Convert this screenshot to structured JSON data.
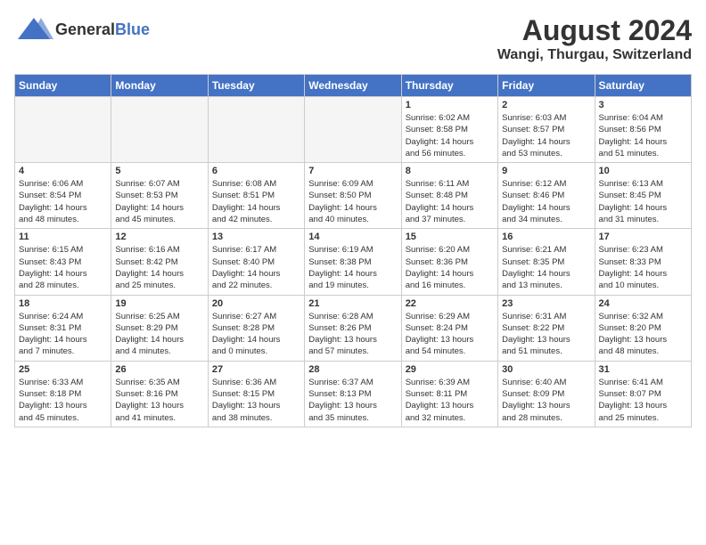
{
  "header": {
    "logo_general": "General",
    "logo_blue": "Blue",
    "month_year": "August 2024",
    "location": "Wangi, Thurgau, Switzerland"
  },
  "days_of_week": [
    "Sunday",
    "Monday",
    "Tuesday",
    "Wednesday",
    "Thursday",
    "Friday",
    "Saturday"
  ],
  "weeks": [
    [
      {
        "day": "",
        "info": ""
      },
      {
        "day": "",
        "info": ""
      },
      {
        "day": "",
        "info": ""
      },
      {
        "day": "",
        "info": ""
      },
      {
        "day": "1",
        "info": "Sunrise: 6:02 AM\nSunset: 8:58 PM\nDaylight: 14 hours\nand 56 minutes."
      },
      {
        "day": "2",
        "info": "Sunrise: 6:03 AM\nSunset: 8:57 PM\nDaylight: 14 hours\nand 53 minutes."
      },
      {
        "day": "3",
        "info": "Sunrise: 6:04 AM\nSunset: 8:56 PM\nDaylight: 14 hours\nand 51 minutes."
      }
    ],
    [
      {
        "day": "4",
        "info": "Sunrise: 6:06 AM\nSunset: 8:54 PM\nDaylight: 14 hours\nand 48 minutes."
      },
      {
        "day": "5",
        "info": "Sunrise: 6:07 AM\nSunset: 8:53 PM\nDaylight: 14 hours\nand 45 minutes."
      },
      {
        "day": "6",
        "info": "Sunrise: 6:08 AM\nSunset: 8:51 PM\nDaylight: 14 hours\nand 42 minutes."
      },
      {
        "day": "7",
        "info": "Sunrise: 6:09 AM\nSunset: 8:50 PM\nDaylight: 14 hours\nand 40 minutes."
      },
      {
        "day": "8",
        "info": "Sunrise: 6:11 AM\nSunset: 8:48 PM\nDaylight: 14 hours\nand 37 minutes."
      },
      {
        "day": "9",
        "info": "Sunrise: 6:12 AM\nSunset: 8:46 PM\nDaylight: 14 hours\nand 34 minutes."
      },
      {
        "day": "10",
        "info": "Sunrise: 6:13 AM\nSunset: 8:45 PM\nDaylight: 14 hours\nand 31 minutes."
      }
    ],
    [
      {
        "day": "11",
        "info": "Sunrise: 6:15 AM\nSunset: 8:43 PM\nDaylight: 14 hours\nand 28 minutes."
      },
      {
        "day": "12",
        "info": "Sunrise: 6:16 AM\nSunset: 8:42 PM\nDaylight: 14 hours\nand 25 minutes."
      },
      {
        "day": "13",
        "info": "Sunrise: 6:17 AM\nSunset: 8:40 PM\nDaylight: 14 hours\nand 22 minutes."
      },
      {
        "day": "14",
        "info": "Sunrise: 6:19 AM\nSunset: 8:38 PM\nDaylight: 14 hours\nand 19 minutes."
      },
      {
        "day": "15",
        "info": "Sunrise: 6:20 AM\nSunset: 8:36 PM\nDaylight: 14 hours\nand 16 minutes."
      },
      {
        "day": "16",
        "info": "Sunrise: 6:21 AM\nSunset: 8:35 PM\nDaylight: 14 hours\nand 13 minutes."
      },
      {
        "day": "17",
        "info": "Sunrise: 6:23 AM\nSunset: 8:33 PM\nDaylight: 14 hours\nand 10 minutes."
      }
    ],
    [
      {
        "day": "18",
        "info": "Sunrise: 6:24 AM\nSunset: 8:31 PM\nDaylight: 14 hours\nand 7 minutes."
      },
      {
        "day": "19",
        "info": "Sunrise: 6:25 AM\nSunset: 8:29 PM\nDaylight: 14 hours\nand 4 minutes."
      },
      {
        "day": "20",
        "info": "Sunrise: 6:27 AM\nSunset: 8:28 PM\nDaylight: 14 hours\nand 0 minutes."
      },
      {
        "day": "21",
        "info": "Sunrise: 6:28 AM\nSunset: 8:26 PM\nDaylight: 13 hours\nand 57 minutes."
      },
      {
        "day": "22",
        "info": "Sunrise: 6:29 AM\nSunset: 8:24 PM\nDaylight: 13 hours\nand 54 minutes."
      },
      {
        "day": "23",
        "info": "Sunrise: 6:31 AM\nSunset: 8:22 PM\nDaylight: 13 hours\nand 51 minutes."
      },
      {
        "day": "24",
        "info": "Sunrise: 6:32 AM\nSunset: 8:20 PM\nDaylight: 13 hours\nand 48 minutes."
      }
    ],
    [
      {
        "day": "25",
        "info": "Sunrise: 6:33 AM\nSunset: 8:18 PM\nDaylight: 13 hours\nand 45 minutes."
      },
      {
        "day": "26",
        "info": "Sunrise: 6:35 AM\nSunset: 8:16 PM\nDaylight: 13 hours\nand 41 minutes."
      },
      {
        "day": "27",
        "info": "Sunrise: 6:36 AM\nSunset: 8:15 PM\nDaylight: 13 hours\nand 38 minutes."
      },
      {
        "day": "28",
        "info": "Sunrise: 6:37 AM\nSunset: 8:13 PM\nDaylight: 13 hours\nand 35 minutes."
      },
      {
        "day": "29",
        "info": "Sunrise: 6:39 AM\nSunset: 8:11 PM\nDaylight: 13 hours\nand 32 minutes."
      },
      {
        "day": "30",
        "info": "Sunrise: 6:40 AM\nSunset: 8:09 PM\nDaylight: 13 hours\nand 28 minutes."
      },
      {
        "day": "31",
        "info": "Sunrise: 6:41 AM\nSunset: 8:07 PM\nDaylight: 13 hours\nand 25 minutes."
      }
    ]
  ]
}
